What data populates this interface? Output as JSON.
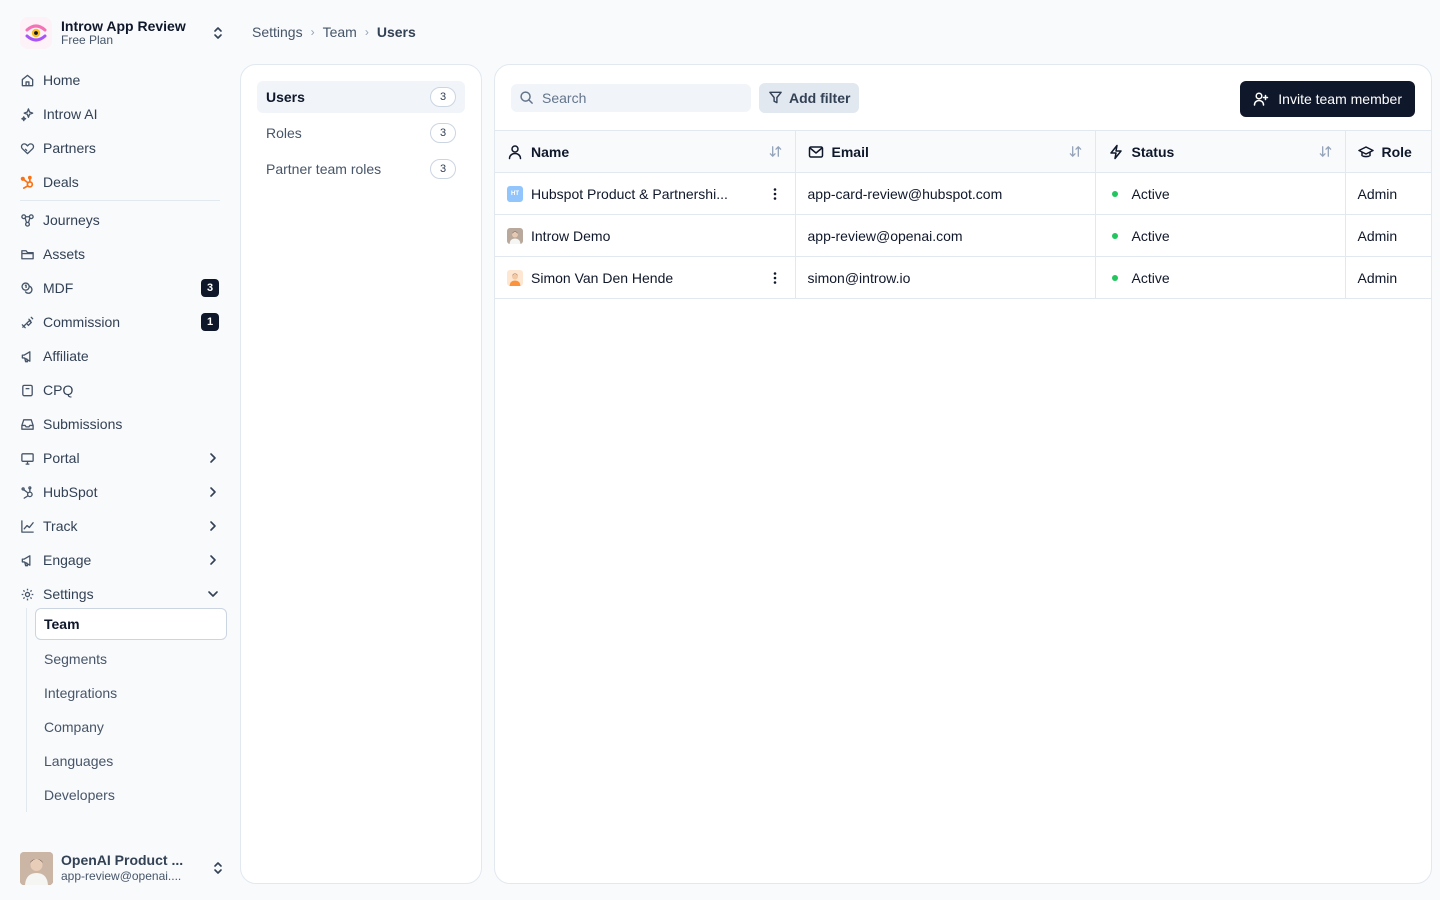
{
  "workspace": {
    "name": "Introw App Review",
    "plan": "Free Plan"
  },
  "nav": [
    {
      "label": "Home",
      "icon": "home-icon"
    },
    {
      "label": "Introw AI",
      "icon": "sparkle-icon"
    },
    {
      "label": "Partners",
      "icon": "handshake-icon"
    },
    {
      "label": "Deals",
      "icon": "hubspot-icon"
    },
    {
      "label": "Journeys",
      "icon": "workflow-icon"
    },
    {
      "label": "Assets",
      "icon": "folder-icon"
    },
    {
      "label": "MDF",
      "icon": "coins-icon",
      "badge": "3"
    },
    {
      "label": "Commission",
      "icon": "money-icon",
      "badge": "1"
    },
    {
      "label": "Affiliate",
      "icon": "megaphone-icon"
    },
    {
      "label": "CPQ",
      "icon": "box-icon"
    },
    {
      "label": "Submissions",
      "icon": "inbox-icon"
    },
    {
      "label": "Portal",
      "icon": "monitor-icon"
    },
    {
      "label": "HubSpot",
      "icon": "hubspot-outline-icon"
    },
    {
      "label": "Track",
      "icon": "chart-icon"
    },
    {
      "label": "Engage",
      "icon": "megaphone-icon"
    },
    {
      "label": "Settings",
      "icon": "gear-icon"
    }
  ],
  "settings_sub": [
    "Team",
    "Segments",
    "Integrations",
    "Company",
    "Languages",
    "Developers"
  ],
  "user": {
    "name": "OpenAI Product ...",
    "email": "app-review@openai...."
  },
  "breadcrumb": [
    "Settings",
    "Team",
    "Users"
  ],
  "sections": [
    {
      "label": "Users",
      "count": "3"
    },
    {
      "label": "Roles",
      "count": "3"
    },
    {
      "label": "Partner team roles",
      "count": "3"
    }
  ],
  "toolbar": {
    "search_placeholder": "Search",
    "filter_label": "Add filter",
    "invite_label": "Invite team member"
  },
  "table": {
    "headers": {
      "name": "Name",
      "email": "Email",
      "status": "Status",
      "role": "Role"
    },
    "rows": [
      {
        "name": "Hubspot Product & Partnershi...",
        "email": "app-card-review@hubspot.com",
        "status": "Active",
        "role": "Admin",
        "avatar_text": "HT"
      },
      {
        "name": "Introw Demo",
        "email": "app-review@openai.com",
        "status": "Active",
        "role": "Admin",
        "avatar_text": ""
      },
      {
        "name": "Simon Van Den Hende",
        "email": "simon@introw.io",
        "status": "Active",
        "role": "Admin",
        "avatar_text": ""
      }
    ]
  },
  "colors": {
    "accent": "#0f172a",
    "active": "#22c55e",
    "hubspot": "#f97316"
  }
}
